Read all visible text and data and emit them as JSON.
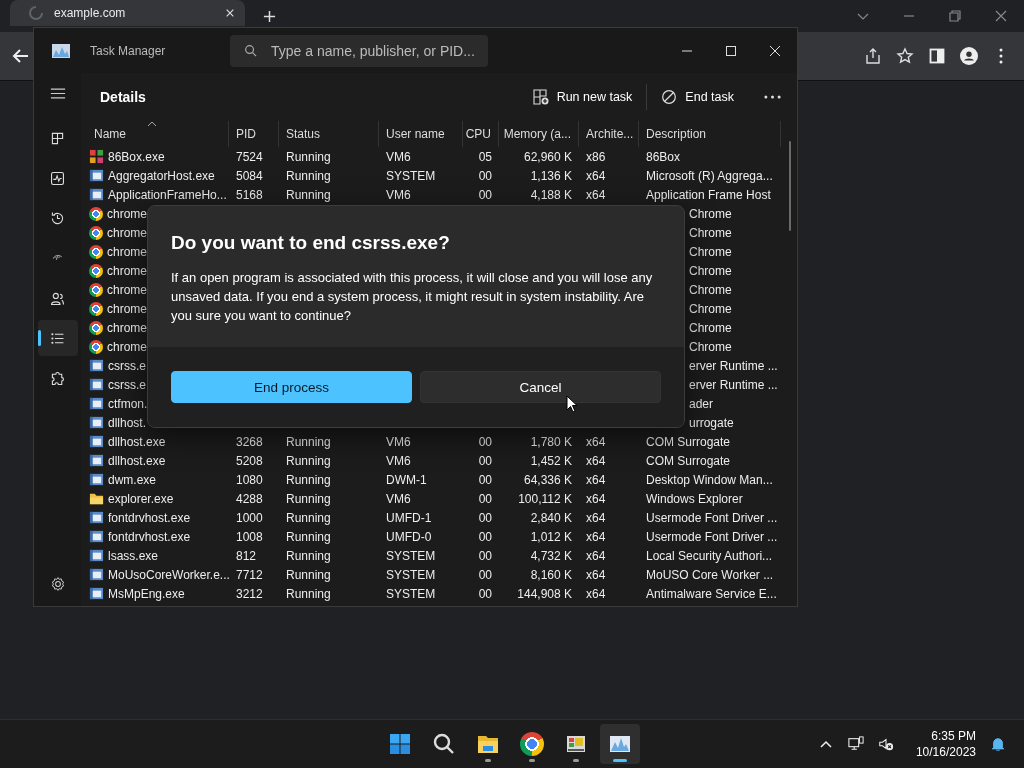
{
  "browser": {
    "tab_title": "example.com"
  },
  "task_manager": {
    "title": "Task Manager",
    "search": {
      "placeholder": "Type a name, publisher, or PID..."
    },
    "nav": [
      {
        "kind": "processes",
        "selected": false
      },
      {
        "kind": "performance",
        "selected": false
      },
      {
        "kind": "history",
        "selected": false
      },
      {
        "kind": "startup",
        "selected": false
      },
      {
        "kind": "users",
        "selected": false
      },
      {
        "kind": "details",
        "selected": true
      },
      {
        "kind": "services",
        "selected": false
      }
    ],
    "page_title": "Details",
    "actions": [
      {
        "kind": "run",
        "label": "Run new task"
      },
      {
        "kind": "end",
        "label": "End task"
      }
    ],
    "columns": [
      {
        "label": "Name",
        "sorted": true
      },
      {
        "label": "PID"
      },
      {
        "label": "Status"
      },
      {
        "label": "User name"
      },
      {
        "label": "CPU"
      },
      {
        "label": "Memory (a..."
      },
      {
        "label": "Archite..."
      },
      {
        "label": "Description"
      }
    ],
    "rows": [
      {
        "kind": "emulator",
        "name": "86Box.exe",
        "pid": "7524",
        "status": "Running",
        "user": "VM6",
        "cpu": "05",
        "memory": "62,960 K",
        "arch": "x86",
        "description": "86Box"
      },
      {
        "kind": "app",
        "name": "AggregatorHost.exe",
        "pid": "5084",
        "status": "Running",
        "user": "SYSTEM",
        "cpu": "00",
        "memory": "1,136 K",
        "arch": "x64",
        "description": "Microsoft (R) Aggrega..."
      },
      {
        "kind": "app",
        "name": "ApplicationFrameHo...",
        "pid": "5168",
        "status": "Running",
        "user": "VM6",
        "cpu": "00",
        "memory": "4,188 K",
        "arch": "x64",
        "description": "Application Frame Host"
      },
      {
        "kind": "browser",
        "name": "chrome",
        "description": "Chrome"
      },
      {
        "kind": "browser",
        "name": "chrome",
        "description": "Chrome"
      },
      {
        "kind": "browser",
        "name": "chrome",
        "description": "Chrome"
      },
      {
        "kind": "browser",
        "name": "chrome",
        "description": "Chrome"
      },
      {
        "kind": "browser",
        "name": "chrome",
        "description": "Chrome"
      },
      {
        "kind": "browser",
        "name": "chrome",
        "description": "Chrome"
      },
      {
        "kind": "browser",
        "name": "chrome",
        "description": "Chrome"
      },
      {
        "kind": "browser",
        "name": "chrome",
        "description": "Chrome"
      },
      {
        "kind": "app",
        "name": "csrss.e",
        "description": "erver Runtime ..."
      },
      {
        "kind": "app",
        "name": "csrss.e",
        "description": "erver Runtime ..."
      },
      {
        "kind": "app",
        "name": "ctfmon.",
        "description": "ader"
      },
      {
        "kind": "app",
        "name": "dllhost.",
        "description": "urrogate"
      },
      {
        "kind": "app",
        "name": "dllhost.exe",
        "pid": "3268",
        "status": "Running",
        "user": "VM6",
        "cpu": "00",
        "memory": "1,780 K",
        "arch": "x64",
        "description": "COM Surrogate"
      },
      {
        "kind": "app",
        "name": "dllhost.exe",
        "pid": "5208",
        "status": "Running",
        "user": "VM6",
        "cpu": "00",
        "memory": "1,452 K",
        "arch": "x64",
        "description": "COM Surrogate"
      },
      {
        "kind": "app",
        "name": "dwm.exe",
        "pid": "1080",
        "status": "Running",
        "user": "DWM-1",
        "cpu": "00",
        "memory": "64,336 K",
        "arch": "x64",
        "description": "Desktop Window Man..."
      },
      {
        "kind": "folder",
        "name": "explorer.exe",
        "pid": "4288",
        "status": "Running",
        "user": "VM6",
        "cpu": "00",
        "memory": "100,112 K",
        "arch": "x64",
        "description": "Windows Explorer"
      },
      {
        "kind": "app",
        "name": "fontdrvhost.exe",
        "pid": "1000",
        "status": "Running",
        "user": "UMFD-1",
        "cpu": "00",
        "memory": "2,840 K",
        "arch": "x64",
        "description": "Usermode Font Driver ..."
      },
      {
        "kind": "app",
        "name": "fontdrvhost.exe",
        "pid": "1008",
        "status": "Running",
        "user": "UMFD-0",
        "cpu": "00",
        "memory": "1,012 K",
        "arch": "x64",
        "description": "Usermode Font Driver ..."
      },
      {
        "kind": "app",
        "name": "lsass.exe",
        "pid": "812",
        "status": "Running",
        "user": "SYSTEM",
        "cpu": "00",
        "memory": "4,732 K",
        "arch": "x64",
        "description": "Local Security Authori..."
      },
      {
        "kind": "app",
        "name": "MoUsoCoreWorker.e...",
        "pid": "7712",
        "status": "Running",
        "user": "SYSTEM",
        "cpu": "00",
        "memory": "8,160 K",
        "arch": "x64",
        "description": "MoUSO Core Worker ..."
      },
      {
        "kind": "app",
        "name": "MsMpEng.exe",
        "pid": "3212",
        "status": "Running",
        "user": "SYSTEM",
        "cpu": "00",
        "memory": "144,908 K",
        "arch": "x64",
        "description": "Antimalware Service E..."
      }
    ]
  },
  "dialog": {
    "title": "Do you want to end csrss.exe?",
    "message": "If an open program is associated with this process, it will close and you will lose any unsaved data. If you end a system process, it might result in system instability. Are you sure you want to continue?",
    "buttons": [
      {
        "kind": "primary",
        "label": "End process"
      },
      {
        "kind": "secondary",
        "label": "Cancel"
      }
    ]
  },
  "taskbar": {
    "apps": [
      {
        "kind": "start",
        "selected": false
      },
      {
        "kind": "search",
        "selected": false
      },
      {
        "kind": "files",
        "running": true,
        "selected": false
      },
      {
        "kind": "browser",
        "running": true,
        "selected": false
      },
      {
        "kind": "emulator",
        "running": true,
        "selected": false
      },
      {
        "kind": "taskmanager",
        "running": true,
        "selected": true
      }
    ],
    "time": "6:35 PM",
    "date": "10/16/2023"
  }
}
